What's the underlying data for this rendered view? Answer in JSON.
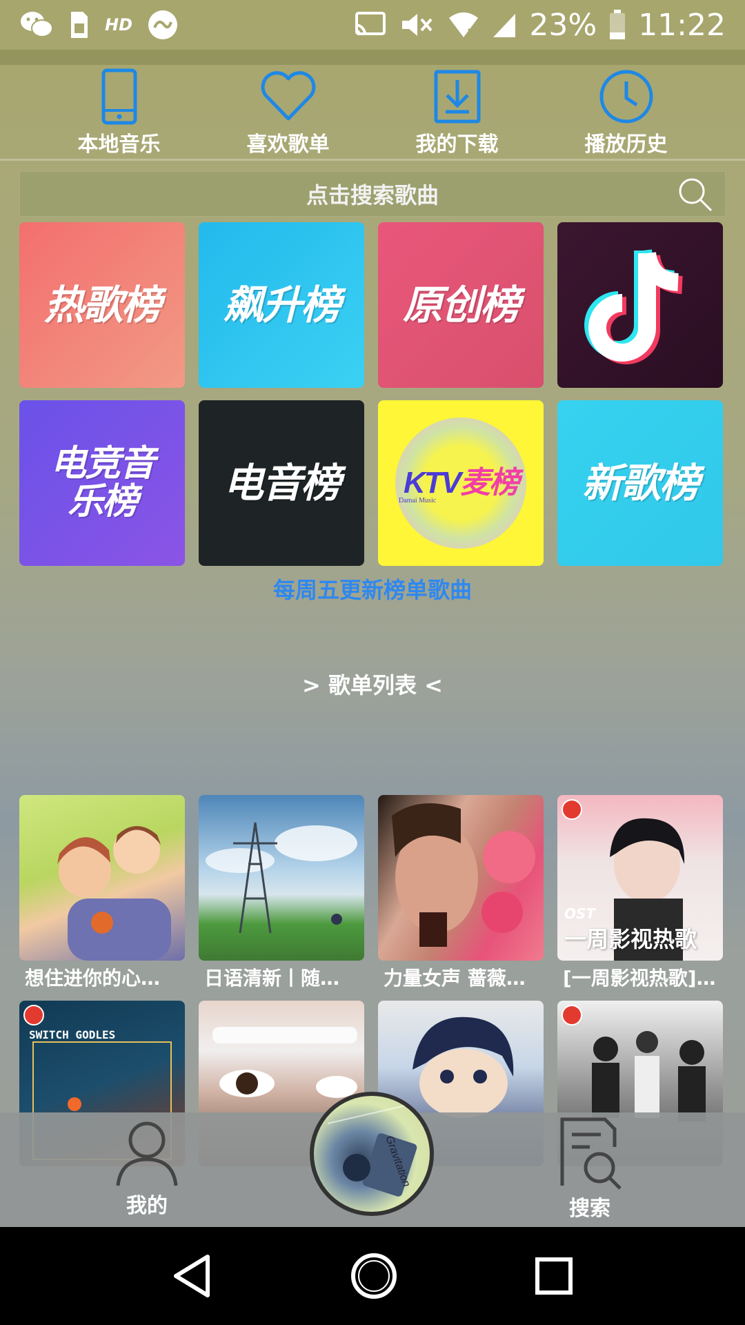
{
  "status_bar": {
    "hd_label": "HD",
    "battery": "23%",
    "time": "11:22"
  },
  "quick_nav": [
    {
      "label": "本地音乐",
      "icon": "tablet-icon"
    },
    {
      "label": "喜欢歌单",
      "icon": "heart-icon"
    },
    {
      "label": "我的下载",
      "icon": "download-icon"
    },
    {
      "label": "播放历史",
      "icon": "clock-icon"
    }
  ],
  "search": {
    "placeholder": "点击搜索歌曲",
    "icon": "search-icon"
  },
  "charts": [
    {
      "title": "热歌榜",
      "color": "#f36f6f"
    },
    {
      "title": "飙升榜",
      "color": "#23b9ec"
    },
    {
      "title": "原创榜",
      "color": "#e9577a"
    },
    {
      "title": "",
      "icon": "tiktok-icon",
      "color": "#2a0e22"
    },
    {
      "title": "电竞音乐榜",
      "color": "#6a52e8"
    },
    {
      "title": "电音榜",
      "color": "#1e2426"
    },
    {
      "title": "KTV 麦榜",
      "ktv": "KTV",
      "mai": "麦榜",
      "sub": "Damai Music",
      "color": "#fef636"
    },
    {
      "title": "新歌榜",
      "color": "#36d2f0"
    }
  ],
  "weekly_note": "每周五更新榜单歌曲",
  "section_title": "> 歌单列表 <",
  "playlists": [
    {
      "name": "想住进你的心…"
    },
    {
      "name": "日语清新丨随…"
    },
    {
      "name": "力量女声 蔷薇…"
    },
    {
      "name": "[一周影视热歌]…",
      "cover_small": "OST",
      "cover_big": "一周影视热歌"
    },
    {
      "name": "",
      "cover_text": "SWITCH GODLES"
    },
    {
      "name": ""
    },
    {
      "name": ""
    },
    {
      "name": ""
    }
  ],
  "bottom_tabs": {
    "me": "我的",
    "search": "搜索"
  },
  "colors": {
    "accent_blue": "#2f88ef",
    "quick_nav_icon": "#1e88e5"
  }
}
